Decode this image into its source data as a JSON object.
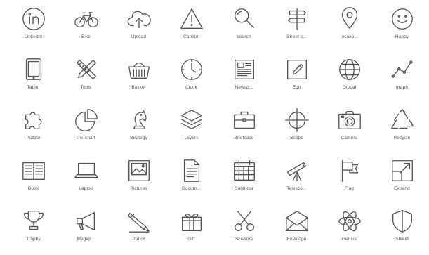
{
  "icons": [
    {
      "label": "Linkedin",
      "icon": "linkedin-icon"
    },
    {
      "label": "Bike",
      "icon": "bike-icon"
    },
    {
      "label": "Upload",
      "icon": "upload-icon"
    },
    {
      "label": "Caution",
      "icon": "caution-icon"
    },
    {
      "label": "search",
      "icon": "search-icon"
    },
    {
      "label": "Street s...",
      "icon": "street-sign-icon"
    },
    {
      "label": "locatio...",
      "icon": "location-icon"
    },
    {
      "label": "Happy",
      "icon": "happy-icon"
    },
    {
      "label": "Tablet",
      "icon": "tablet-icon"
    },
    {
      "label": "Tools",
      "icon": "tools-icon"
    },
    {
      "label": "Basket",
      "icon": "basket-icon"
    },
    {
      "label": "Clock",
      "icon": "clock-icon"
    },
    {
      "label": "Newsp...",
      "icon": "newspaper-icon"
    },
    {
      "label": "Edit",
      "icon": "edit-icon"
    },
    {
      "label": "Global",
      "icon": "global-icon"
    },
    {
      "label": "graph",
      "icon": "graph-icon"
    },
    {
      "label": "Puzzle",
      "icon": "puzzle-icon"
    },
    {
      "label": "Pie-chart",
      "icon": "pie-chart-icon"
    },
    {
      "label": "Strategy",
      "icon": "strategy-icon"
    },
    {
      "label": "Layers",
      "icon": "layers-icon"
    },
    {
      "label": "Briefcase",
      "icon": "briefcase-icon"
    },
    {
      "label": "Scope",
      "icon": "scope-icon"
    },
    {
      "label": "Camera",
      "icon": "camera-icon"
    },
    {
      "label": "Recycle",
      "icon": "recycle-icon"
    },
    {
      "label": "Book",
      "icon": "book-icon"
    },
    {
      "label": "Laptop",
      "icon": "laptop-icon"
    },
    {
      "label": "Pictures",
      "icon": "pictures-icon"
    },
    {
      "label": "Docum...",
      "icon": "document-icon"
    },
    {
      "label": "Calendar",
      "icon": "calendar-icon"
    },
    {
      "label": "Telesco...",
      "icon": "telescope-icon"
    },
    {
      "label": "Flag",
      "icon": "flag-icon"
    },
    {
      "label": "Expand",
      "icon": "expand-icon"
    },
    {
      "label": "Trophy",
      "icon": "trophy-icon"
    },
    {
      "label": "Megap...",
      "icon": "megaphone-icon"
    },
    {
      "label": "Pencil",
      "icon": "pencil-icon"
    },
    {
      "label": "Gift",
      "icon": "gift-icon"
    },
    {
      "label": "Scissors",
      "icon": "scissors-icon"
    },
    {
      "label": "Envelope",
      "icon": "envelope-icon"
    },
    {
      "label": "Genius",
      "icon": "genius-icon"
    },
    {
      "label": "Shield",
      "icon": "shield-icon"
    }
  ]
}
